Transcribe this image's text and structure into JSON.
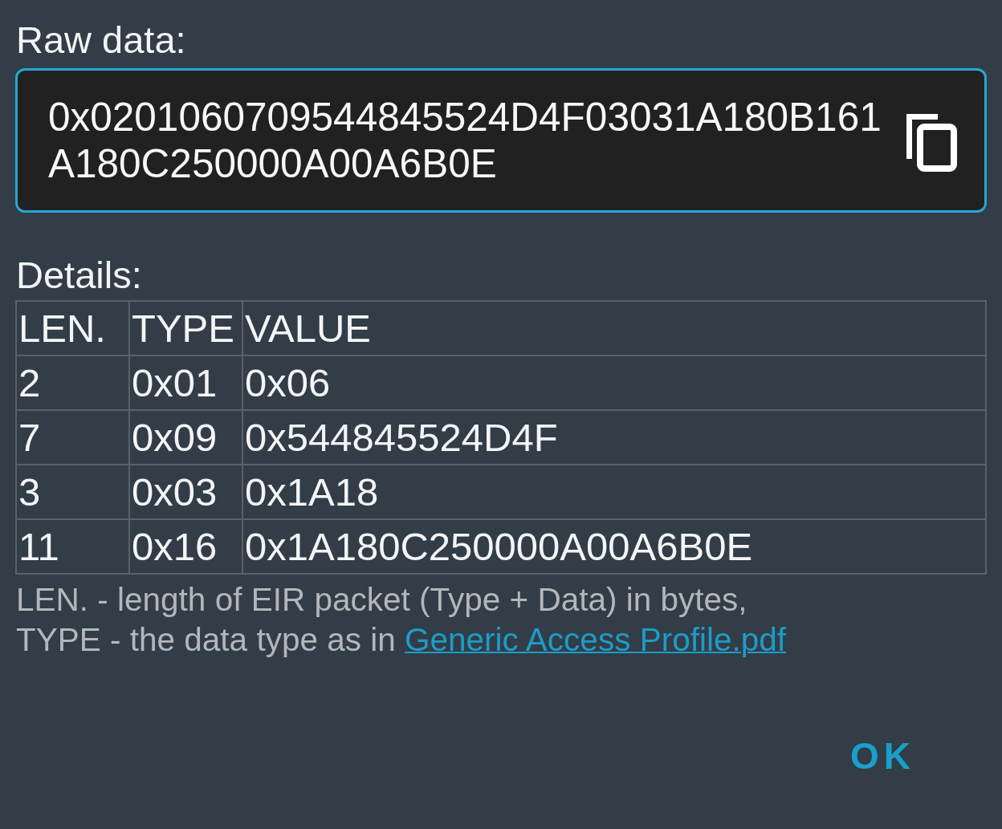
{
  "raw_data": {
    "label": "Raw data:",
    "value": "0x0201060709544845524D4F03031A180B161A180C250000A00A6B0E"
  },
  "details": {
    "label": "Details:",
    "columns": [
      "LEN.",
      "TYPE",
      "VALUE"
    ],
    "rows": [
      [
        "2",
        "0x01",
        "0x06"
      ],
      [
        "7",
        "0x09",
        "0x544845524D4F"
      ],
      [
        "3",
        "0x03",
        "0x1A18"
      ],
      [
        "11",
        "0x16",
        "0x1A180C250000A00A6B0E"
      ]
    ]
  },
  "legend": {
    "lines": [
      "LEN. - length of EIR packet (Type + Data) in bytes,",
      "TYPE - the data type as in "
    ],
    "link": "Generic Access Profile.pdf"
  },
  "buttons": [
    "OK"
  ]
}
